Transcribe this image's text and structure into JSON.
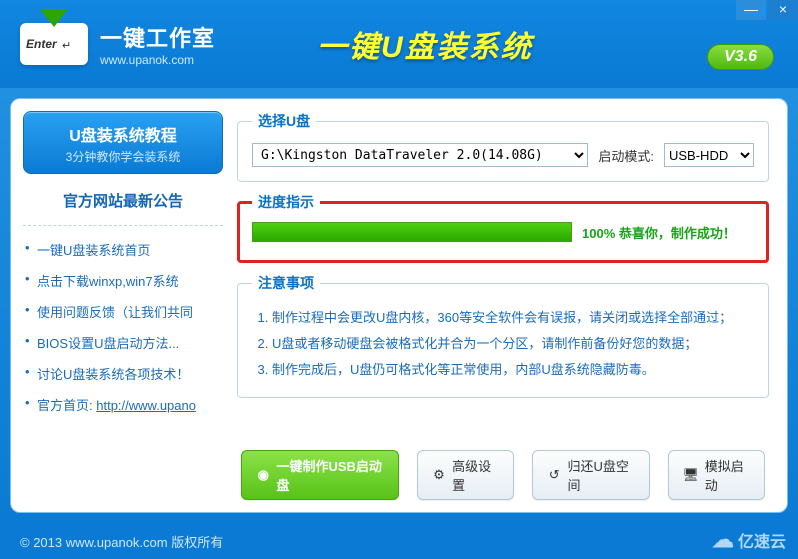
{
  "window": {
    "minimize": "—",
    "close": "×"
  },
  "logo": {
    "cn": "一键工作室",
    "url": "www.upanok.com",
    "enter": "Enter"
  },
  "header": {
    "title": "一键U盘装系统",
    "version": "V3.6"
  },
  "sidebar": {
    "tutorial": {
      "title": "U盘装系统教程",
      "sub": "3分钟教你学会装系统"
    },
    "announce": "官方网站最新公告",
    "items": [
      "一键U盘装系统首页",
      "点击下载winxp,win7系统",
      "使用问题反馈（让我们共同",
      "BIOS设置U盘启动方法...",
      "讨论U盘装系统各项技术！"
    ],
    "home_label": "官方首页: ",
    "home_url": "http://www.upano"
  },
  "select": {
    "legend": "选择U盘",
    "drive": "G:\\Kingston DataTraveler 2.0(14.08G)",
    "boot_label": "启动模式:",
    "boot_mode": "USB-HDD"
  },
  "progress": {
    "legend": "进度指示",
    "percent": 100,
    "text": "100%  恭喜你，制作成功！"
  },
  "notes": {
    "legend": "注意事项",
    "items": [
      "制作过程中会更改U盘内核，360等安全软件会有误报，请关闭或选择全部通过；",
      "U盘或者移动硬盘会被格式化并合为一个分区，请制作前备份好您的数据；",
      "制作完成后，U盘仍可格式化等正常使用，内部U盘系统隐藏防毒。"
    ]
  },
  "actions": {
    "make": "一键制作USB启动盘",
    "advanced": "高级设置",
    "restore": "归还U盘空间",
    "simulate": "模拟启动"
  },
  "footer": {
    "copyright": "© 2013 www.upanok.com   版权所有"
  },
  "watermark": "亿速云"
}
